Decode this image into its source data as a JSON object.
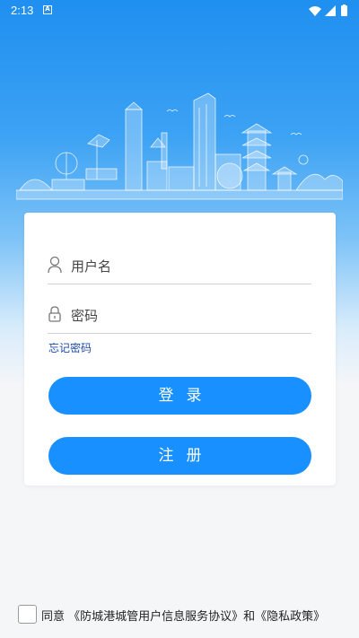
{
  "status_bar": {
    "time": "2:13",
    "notification_icon": "a-icon",
    "wifi_icon": "wifi-icon",
    "signal_icon": "signal-icon",
    "battery_icon": "battery-icon"
  },
  "hero": {
    "illustration": "city-skyline-illustration"
  },
  "login_form": {
    "username": {
      "value": "",
      "placeholder": "用户名",
      "icon": "user-icon"
    },
    "password": {
      "value": "",
      "placeholder": "密码",
      "icon": "lock-icon"
    },
    "forgot_password": "忘记密码",
    "login_button": "登录",
    "register_button": "注册"
  },
  "agreement": {
    "checked": false,
    "text": "同意 《防城港城管用户信息服务协议》和《隐私政策》"
  },
  "colors": {
    "primary": "#1890ff",
    "hero_top": "#1f8ff0",
    "link": "#1f4aa8",
    "background": "#f5f6f8"
  }
}
